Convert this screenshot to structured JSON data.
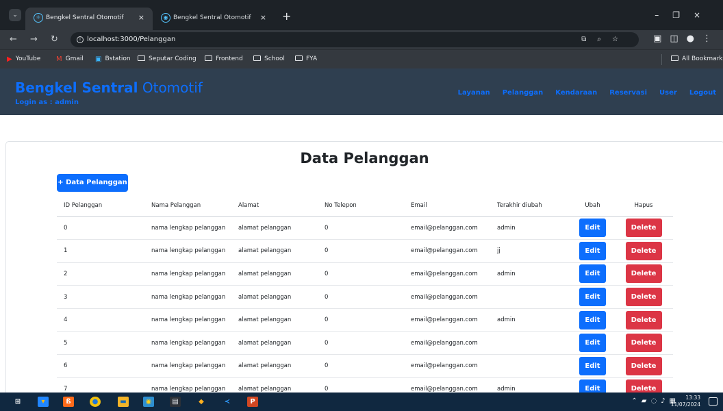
{
  "browser": {
    "tabs": [
      {
        "title": "Bengkel Sentral Otomotif",
        "active": true
      },
      {
        "title": "Bengkel Sentral Otomotif",
        "active": false
      }
    ],
    "url": "localhost:3000/Pelanggan",
    "bookmarks": [
      "YouTube",
      "Gmail",
      "Bstation",
      "Seputar Coding",
      "Frontend",
      "School",
      "FYA"
    ],
    "all_bookmarks": "All Bookmarks"
  },
  "app": {
    "brand_bold": "Bengkel Sentral",
    "brand_light": "Otomotif",
    "login_as": "Login as : admin",
    "nav": [
      "Layanan",
      "Pelanggan",
      "Kendaraan",
      "Reservasi",
      "User",
      "Logout"
    ],
    "page_title": "Data Pelanggan",
    "add_button": "+ Data Pelanggan",
    "table": {
      "headers": [
        "ID Pelanggan",
        "Nama Pelanggan",
        "Alamat",
        "No Telepon",
        "Email",
        "Terakhir diubah",
        "Ubah",
        "Hapus"
      ],
      "rows": [
        [
          "0",
          "nama lengkap pelanggan",
          "alamat pelanggan",
          "0",
          "email@pelanggan.com",
          "admin"
        ],
        [
          "1",
          "nama lengkap pelanggan",
          "alamat pelanggan",
          "0",
          "email@pelanggan.com",
          "jj"
        ],
        [
          "2",
          "nama lengkap pelanggan",
          "alamat pelanggan",
          "0",
          "email@pelanggan.com",
          "admin"
        ],
        [
          "3",
          "nama lengkap pelanggan",
          "alamat pelanggan",
          "0",
          "email@pelanggan.com",
          ""
        ],
        [
          "4",
          "nama lengkap pelanggan",
          "alamat pelanggan",
          "0",
          "email@pelanggan.com",
          "admin"
        ],
        [
          "5",
          "nama lengkap pelanggan",
          "alamat pelanggan",
          "0",
          "email@pelanggan.com",
          ""
        ],
        [
          "6",
          "nama lengkap pelanggan",
          "alamat pelanggan",
          "0",
          "email@pelanggan.com",
          ""
        ],
        [
          "7",
          "nama lengkap pelanggan",
          "alamat pelanggan",
          "0",
          "email@pelanggan.com",
          "admin"
        ]
      ],
      "edit_label": "Edit",
      "delete_label": "Delete"
    }
  },
  "taskbar": {
    "time": "13:33",
    "date": "11/07/2024"
  },
  "colors": {
    "primary": "#0d6efd",
    "danger": "#dc3545",
    "header": "#2f3f50"
  }
}
